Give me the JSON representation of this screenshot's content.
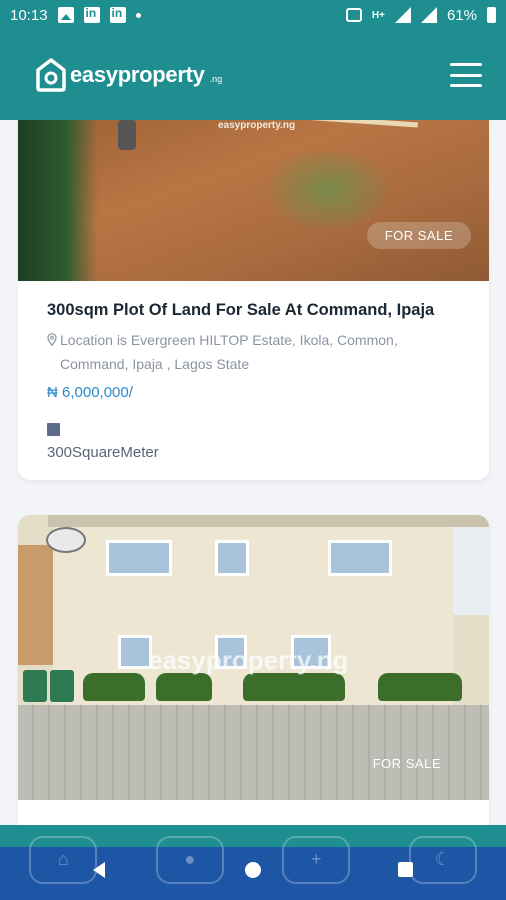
{
  "status_bar": {
    "time": "10:13",
    "network": "H+",
    "battery": "61%"
  },
  "header": {
    "logo_text": "easyproperty",
    "logo_suffix": ".ng"
  },
  "listings": [
    {
      "title": "300sqm Plot Of Land For Sale At Command, Ipaja",
      "location": "Location is Evergreen HILTOP Estate, Ikola, Common, Command, Ipaja , Lagos State",
      "price": "₦ 6,000,000/",
      "feature": "300SquareMeter",
      "badge": "FOR SALE",
      "watermark": "easyproperty.ng"
    },
    {
      "badge": "FOR SALE",
      "watermark": "easyproperty.ng"
    }
  ],
  "bottom_nav": {
    "icons": [
      "home-icon",
      "user-icon",
      "plus-icon",
      "moon-icon"
    ]
  },
  "colors": {
    "teal": "#1f8e90",
    "nav_blue": "#1e56a6",
    "price_blue": "#2a88c8"
  }
}
